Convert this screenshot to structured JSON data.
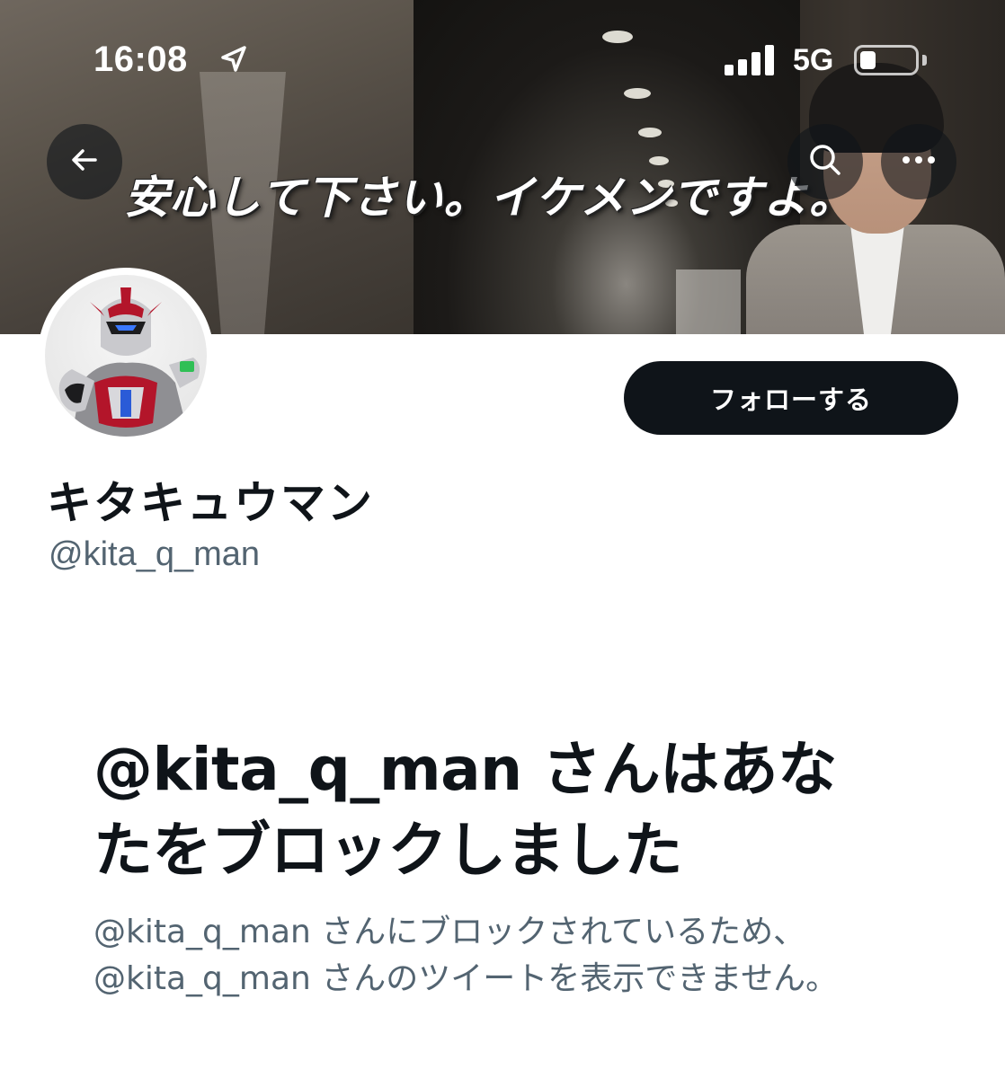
{
  "status_bar": {
    "time": "16:08",
    "network": "5G",
    "signal_bars": 4,
    "battery_level": 0.3,
    "icons": [
      "location-arrow-icon",
      "signal-icon",
      "battery-icon"
    ]
  },
  "header": {
    "banner_caption": "安心して下さい。イケメンですよ。",
    "icons": [
      "back-arrow-icon",
      "search-icon",
      "more-icon"
    ]
  },
  "profile": {
    "display_name": "キタキュウマン",
    "handle": "@kita_q_man",
    "follow_label": "フォローする"
  },
  "blocked": {
    "title_line1": "@kita_q_man さんはあな",
    "title_line2": "たをブロックしました",
    "desc_line1": "@kita_q_man さんにブロックされているため、",
    "desc_line2": "@kita_q_man さんのツイートを表示できません。"
  },
  "colors": {
    "primary_text": "#0f1419",
    "secondary_text": "#536471",
    "button_bg": "#0f1419",
    "button_text": "#ffffff",
    "background": "#ffffff"
  }
}
